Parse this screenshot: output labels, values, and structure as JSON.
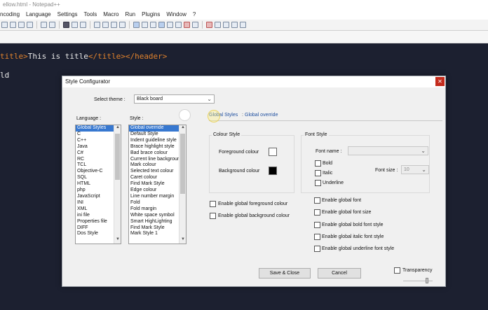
{
  "window": {
    "title": "ellow.html - Notepad++",
    "menu": [
      "ncoding",
      "Language",
      "Settings",
      "Tools",
      "Macro",
      "Run",
      "Plugins",
      "Window",
      "?"
    ]
  },
  "editor": {
    "line1": {
      "tag_open": "title>",
      "text": "This is title",
      "tag_close": "</title></header>"
    },
    "line2": "ld"
  },
  "dialog": {
    "title": "Style Configurator",
    "close_label": "✕",
    "select_theme_label": "Select theme :",
    "theme_value": "Black board",
    "language_label": "Language :",
    "style_label": "Style :",
    "languages": [
      "Global Styles",
      "C",
      "C++",
      "Java",
      "C#",
      "RC",
      "TCL",
      "Objective-C",
      "SQL",
      "HTML",
      "php",
      "JavaScript",
      "INI",
      "XML",
      "ini file",
      "Properties file",
      "DIFF",
      "Dos Style"
    ],
    "styles": [
      "Global override",
      "Default Style",
      "Indent guideline style",
      "Brace highlight style",
      "Bad brace colour",
      "Current line background",
      "Mark colour",
      "Selected text colour",
      "Caret colour",
      "Find Mark Style",
      "Edge colour",
      "Line number margin",
      "Fold",
      "Fold margin",
      "White space symbol",
      "Smart HighLighting",
      "Find Mark Style",
      "Mark Style 1"
    ],
    "tabs": {
      "global_styles": "Global Styles",
      "separator": ":",
      "global_override": "Global override"
    },
    "colour_style": {
      "title": "Colour Style",
      "foreground_label": "Foreground colour",
      "background_label": "Background colour",
      "foreground_color": "#ffffff",
      "background_color": "#000000"
    },
    "font_style": {
      "title": "Font Style",
      "font_name_label": "Font name :",
      "font_name_value": "",
      "bold_label": "Bold",
      "italic_label": "Italic",
      "underline_label": "Underline",
      "font_size_label": "Font size :",
      "font_size_value": "10"
    },
    "enable_options_left": [
      "Enable global foreground colour",
      "Enable global background colour"
    ],
    "enable_options_right": [
      "Enable global font",
      "Enable global font size",
      "Enable global bold font style",
      "Enable global italic font style",
      "Enable global underline font style"
    ],
    "buttons": {
      "save_close": "Save & Close",
      "cancel": "Cancel"
    },
    "transparency_label": "Transparency"
  }
}
